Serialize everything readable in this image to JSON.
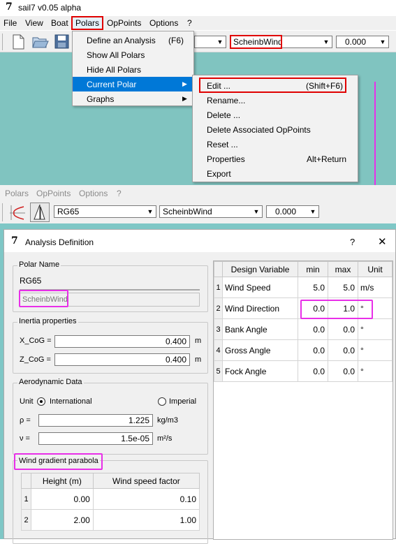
{
  "app": {
    "title": "sail7 v0.05 alpha",
    "logo": "7"
  },
  "menubar": [
    "File",
    "View",
    "Boat",
    "Polars",
    "OpPoints",
    "Options",
    "?"
  ],
  "toolbar": {
    "polar_combo": "ScheinbWind",
    "value_combo": "0.000"
  },
  "polars_menu": [
    {
      "label": "Define an Analysis",
      "shortcut": "(F6)"
    },
    {
      "label": "Show All Polars",
      "shortcut": ""
    },
    {
      "label": "Hide All Polars",
      "shortcut": ""
    },
    {
      "label": "Current Polar",
      "shortcut": ""
    },
    {
      "label": "Graphs",
      "shortcut": ""
    }
  ],
  "current_polar_submenu": [
    {
      "label": "Edit ...",
      "shortcut": "(Shift+F6)"
    },
    {
      "label": "Rename...",
      "shortcut": ""
    },
    {
      "label": "Delete ...",
      "shortcut": ""
    },
    {
      "label": "Delete Associated OpPoints",
      "shortcut": ""
    },
    {
      "label": "Reset ...",
      "shortcut": ""
    },
    {
      "label": "Properties",
      "shortcut": "Alt+Return"
    },
    {
      "label": "Export",
      "shortcut": ""
    }
  ],
  "menubar2": [
    "Polars",
    "OpPoints",
    "Options",
    "?"
  ],
  "toolbar2": {
    "boat_combo": "RG65",
    "polar_combo": "ScheinbWind",
    "value_combo": "0.000"
  },
  "dialog": {
    "title": "Analysis Definition",
    "help": "?",
    "close": "✕",
    "polar_name_group": "Polar Name",
    "boat_name": "RG65",
    "polar_name": "ScheinbWind",
    "inertia_group": "Inertia properties",
    "xcog_label": "X_CoG =",
    "xcog_value": "0.400",
    "xcog_unit": "m",
    "zcog_label": "Z_CoG =",
    "zcog_value": "0.400",
    "zcog_unit": "m",
    "aero_group": "Aerodynamic Data",
    "unit_label": "Unit",
    "unit_international": "International",
    "unit_imperial": "Imperial",
    "rho_label": "ρ =",
    "rho_value": "1.225",
    "rho_unit": "kg/m3",
    "nu_label": "ν =",
    "nu_value": "1.5e-05",
    "nu_unit": "m²/s",
    "gradient_group": "Wind gradient parabola",
    "gradient_headers": [
      "Height (m)",
      "Wind speed factor"
    ],
    "gradient_rows": [
      {
        "n": "1",
        "height": "0.00",
        "factor": "0.10"
      },
      {
        "n": "2",
        "height": "2.00",
        "factor": "1.00"
      }
    ],
    "design_headers": [
      "Design Variable",
      "min",
      "max",
      "Unit"
    ],
    "design_rows": [
      {
        "n": "1",
        "name": "Wind Speed",
        "min": "5.0",
        "max": "5.0",
        "unit": "m/s"
      },
      {
        "n": "2",
        "name": "Wind Direction",
        "min": "0.0",
        "max": "1.0",
        "unit": "°"
      },
      {
        "n": "3",
        "name": "Bank Angle",
        "min": "0.0",
        "max": "0.0",
        "unit": "°"
      },
      {
        "n": "4",
        "name": "Gross Angle",
        "min": "0.0",
        "max": "0.0",
        "unit": "°"
      },
      {
        "n": "5",
        "name": "Fock Angle",
        "min": "0.0",
        "max": "0.0",
        "unit": "°"
      }
    ]
  },
  "highlight_colors": {
    "red": "#e00000",
    "magenta": "#e82fe8",
    "menu_selection": "#0078d7",
    "teal": "#80c4c0"
  }
}
